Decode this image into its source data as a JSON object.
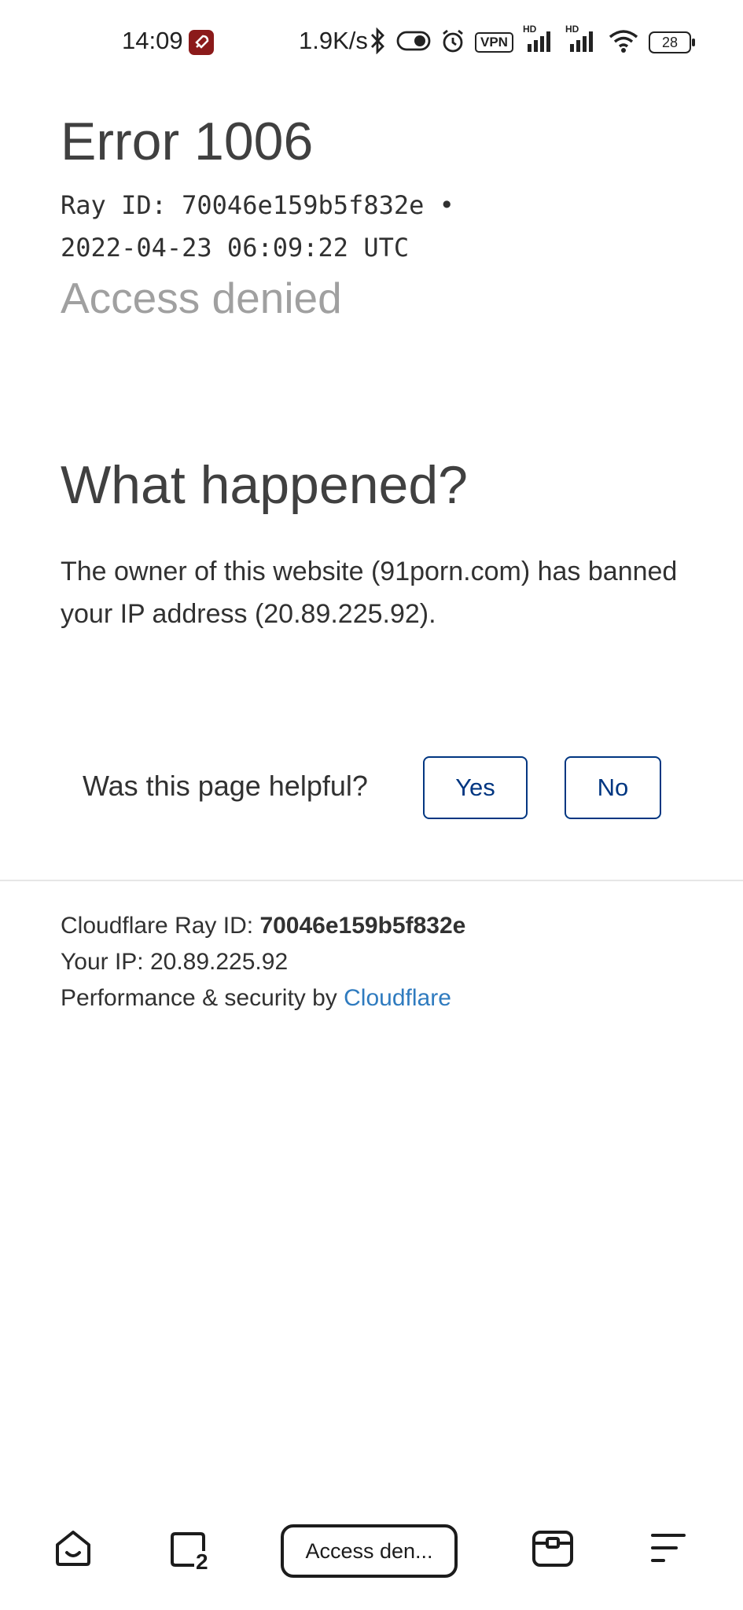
{
  "status_bar": {
    "time": "14:09",
    "net_speed": "1.9K/s",
    "vpn": "VPN",
    "hd1": "HD",
    "hd2": "HD",
    "battery": "28",
    "icons": [
      "rocket-app-icon",
      "bluetooth-icon",
      "toggle-icon",
      "alarm-icon",
      "vpn-icon",
      "signal-icon",
      "signal-icon",
      "wifi-icon",
      "battery-icon"
    ]
  },
  "error": {
    "title": "Error 1006",
    "ray_line1": "Ray ID: 70046e159b5f832e •",
    "ray_line2": "2022-04-23 06:09:22 UTC",
    "subtitle": "Access denied"
  },
  "what_happened": {
    "heading": "What happened?",
    "body": "The owner of this website (91porn.com) has banned your IP address (20.89.225.92)."
  },
  "feedback": {
    "question": "Was this page helpful?",
    "yes_label": "Yes",
    "no_label": "No"
  },
  "footer": {
    "ray_label": "Cloudflare Ray ID: ",
    "ray_id": "70046e159b5f832e",
    "ip_line": "Your IP: 20.89.225.92",
    "perf_prefix": "Performance & security by ",
    "cloudflare_link": "Cloudflare"
  },
  "bottom_nav": {
    "tab_count": "2",
    "address_label": "Access den..."
  },
  "colors": {
    "button_border": "#003681",
    "link": "#2f7bbf",
    "text": "#313131",
    "muted": "#a0a0a0"
  }
}
